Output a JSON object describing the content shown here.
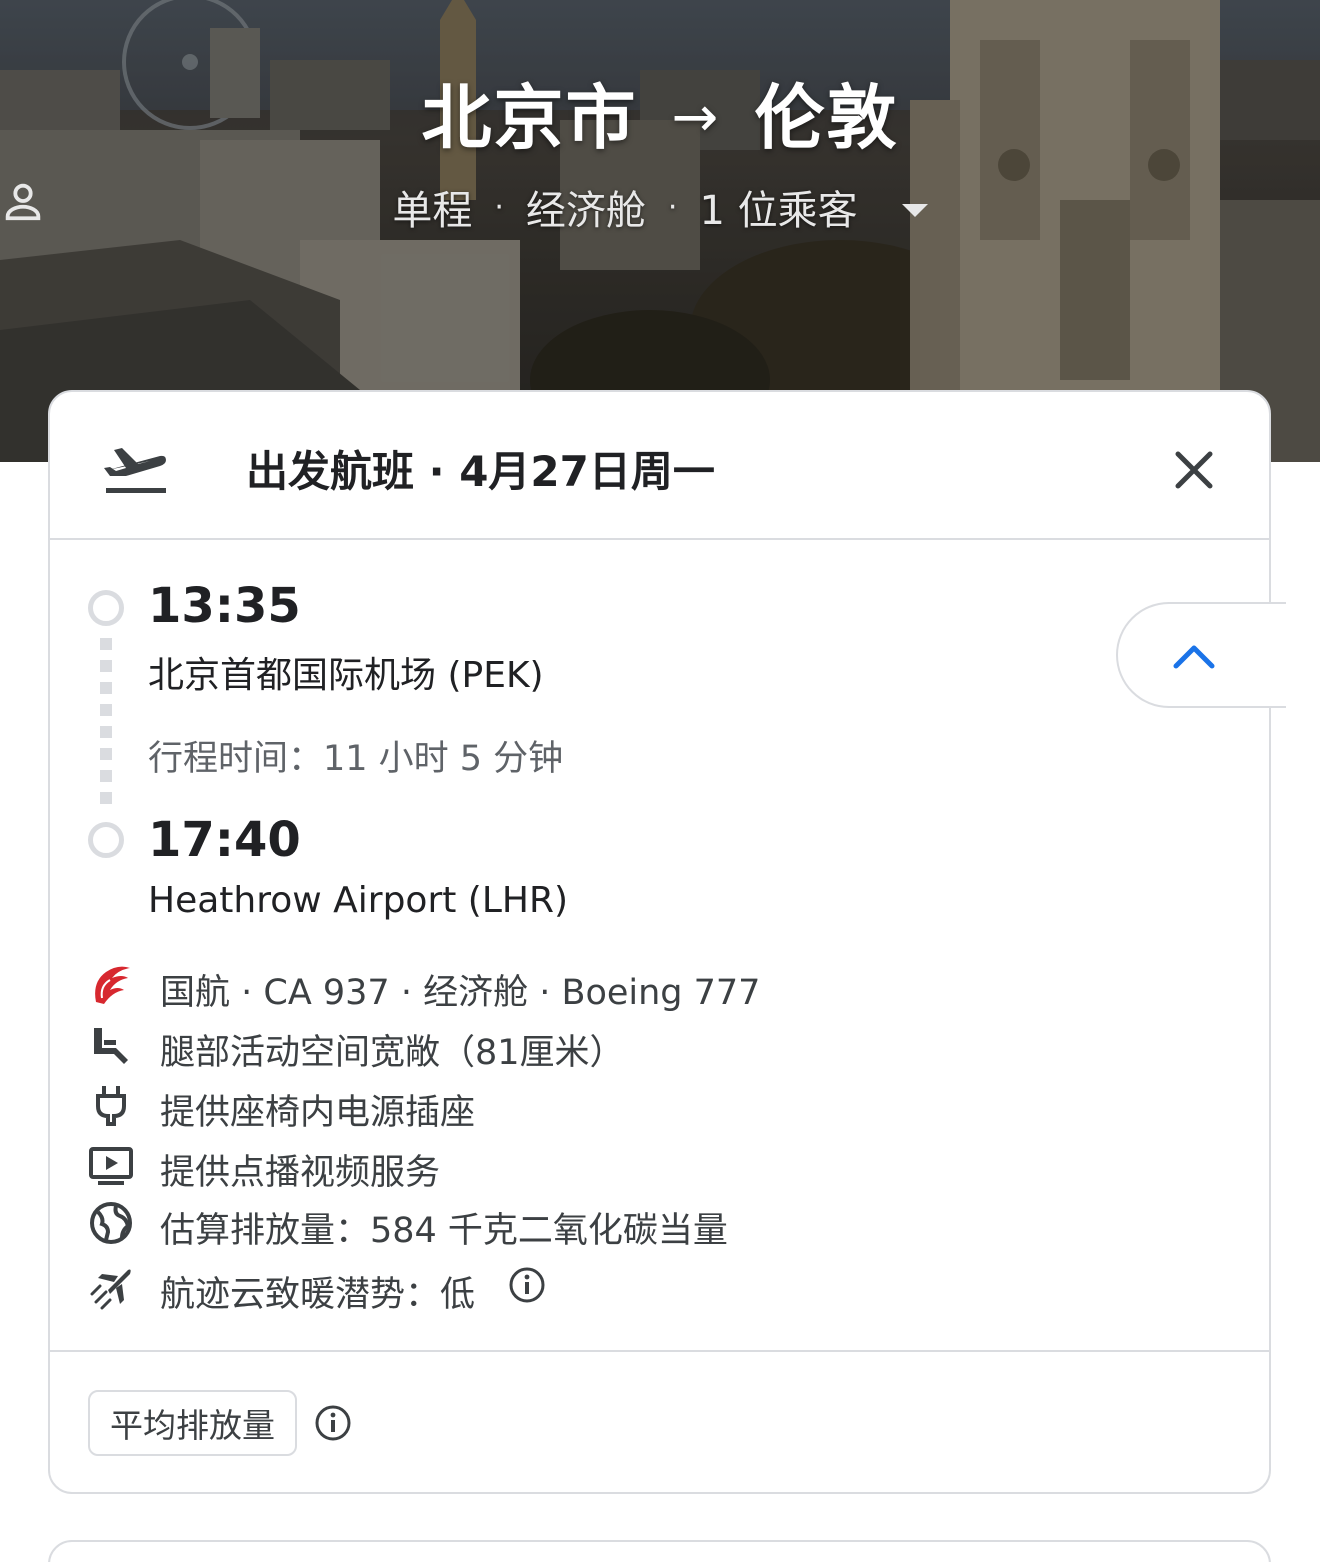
{
  "header": {
    "origin": "北京市",
    "arrow": "→",
    "destination": "伦敦",
    "trip_type": "单程",
    "cabin_class": "经济舱",
    "separator": "·",
    "passengers": "1 位乘客"
  },
  "card": {
    "title": "出发航班 · 4月27日周一",
    "departure": {
      "time": "13:35",
      "airport": "北京首都国际机场 (PEK)"
    },
    "duration": "行程时间：11 小时 5 分钟",
    "arrival": {
      "time": "17:40",
      "airport": "Heathrow Airport (LHR)"
    },
    "features": [
      {
        "icon": "air-china-logo",
        "text": "国航 · CA 937 · 经济舱 · Boeing 777"
      },
      {
        "icon": "legroom-seat-icon",
        "text": "腿部活动空间宽敞（81厘米）"
      },
      {
        "icon": "power-plug-icon",
        "text": "提供座椅内电源插座"
      },
      {
        "icon": "video-screen-icon",
        "text": "提供点播视频服务"
      },
      {
        "icon": "globe-icon",
        "text": "估算排放量：584 千克二氧化碳当量"
      },
      {
        "icon": "contrail-plane-icon",
        "text": "航迹云致暖潜势：低"
      }
    ],
    "emissions_chip": "平均排放量"
  },
  "colors": {
    "accent": "#1a73e8",
    "air_china_red": "#d7282f",
    "border": "#dadce0",
    "secondary_text": "#5f6368"
  }
}
